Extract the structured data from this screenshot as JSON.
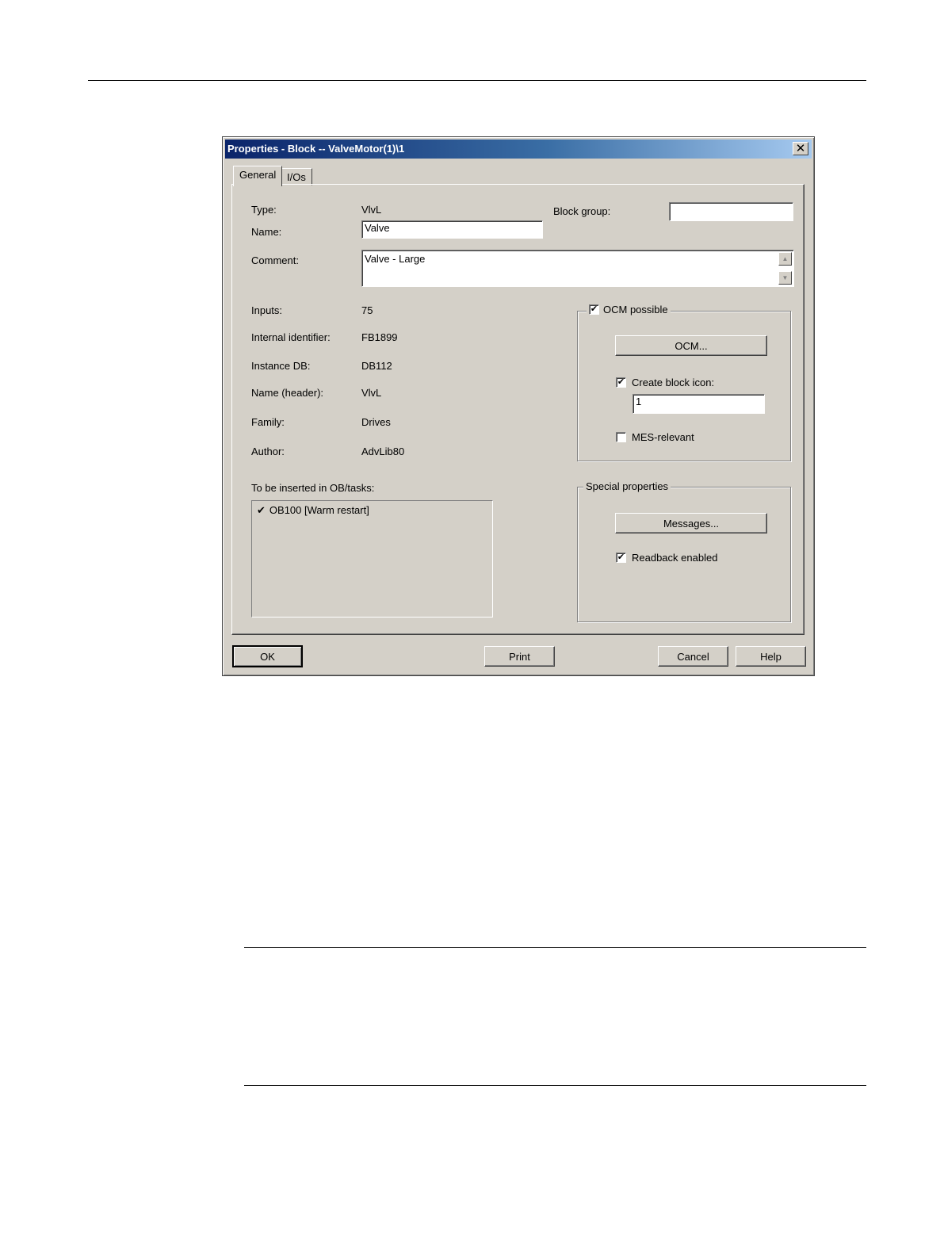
{
  "dialog": {
    "title": "Properties - Block -- ValveMotor(1)\\1",
    "close_glyph": "✕",
    "tabs": [
      {
        "label": "General"
      },
      {
        "label": "I/Os"
      }
    ],
    "general": {
      "type_label": "Type:",
      "type_value": "VlvL",
      "name_label": "Name:",
      "name_value": "Valve",
      "block_group_label": "Block group:",
      "block_group_value": "",
      "comment_label": "Comment:",
      "comment_value": "Valve - Large",
      "inputs_label": "Inputs:",
      "inputs_value": "75",
      "internal_id_label": "Internal identifier:",
      "internal_id_value": "FB1899",
      "instance_db_label": "Instance DB:",
      "instance_db_value": "DB112",
      "name_header_label": "Name (header):",
      "name_header_value": "VlvL",
      "family_label": "Family:",
      "family_value": "Drives",
      "author_label": "Author:",
      "author_value": "AdvLib80",
      "ob_tasks_label": "To be inserted in OB/tasks:",
      "ob_tasks_items": [
        "OB100 [Warm restart]"
      ]
    },
    "ocm": {
      "possible_label": "OCM possible",
      "possible_checked": true,
      "button_label": "OCM...",
      "create_icon_label": "Create block icon:",
      "create_icon_checked": true,
      "icon_value": "1",
      "mes_label": "MES-relevant",
      "mes_checked": false
    },
    "special": {
      "group_label": "Special properties",
      "messages_button": "Messages...",
      "readback_label": "Readback enabled",
      "readback_checked": true
    },
    "buttons": {
      "ok": "OK",
      "print": "Print",
      "cancel": "Cancel",
      "help": "Help"
    },
    "check_glyph": "✔"
  }
}
